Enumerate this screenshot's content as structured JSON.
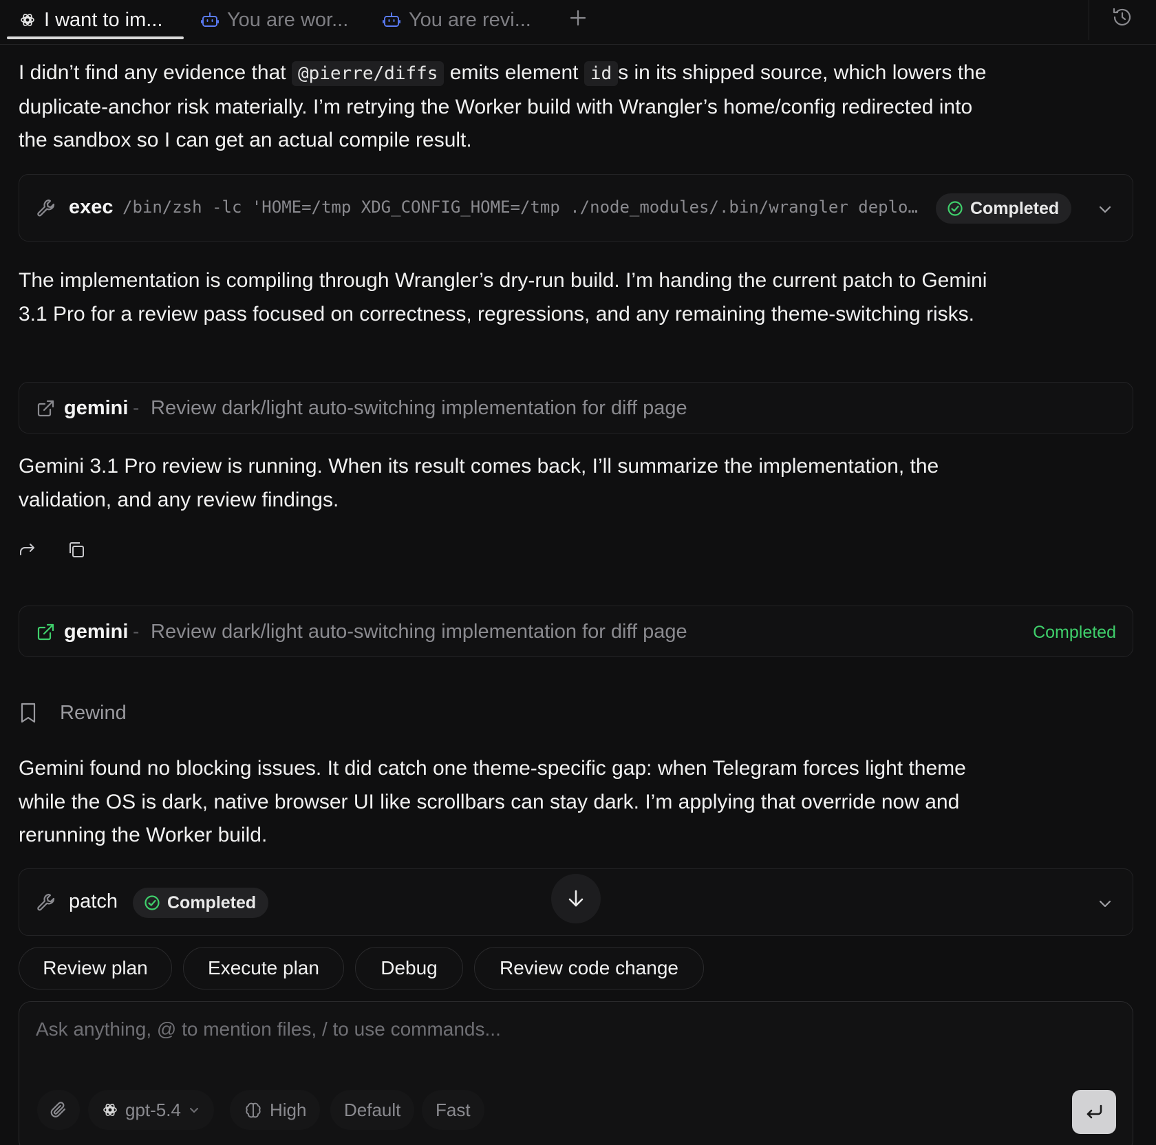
{
  "tabs": [
    {
      "label": "I want to im...",
      "icon": "openai-icon",
      "active": true
    },
    {
      "label": "You are wor...",
      "icon": "robot-icon",
      "active": false
    },
    {
      "label": "You are revi...",
      "icon": "robot-icon",
      "active": false
    }
  ],
  "messages": {
    "m1": {
      "t1": "I didn’t find any evidence that ",
      "c1": "@pierre/diffs",
      "t2": " emits element ",
      "c2": "id",
      "t3": "s in its shipped source, which lowers the duplicate-anchor risk materially. I’m retrying the Worker build with Wrangler’s home/config redirected into the sandbox so I can get an actual compile result."
    },
    "m2": "The implementation is compiling through Wrangler’s dry-run build. I’m handing the current patch to Gemini 3.1 Pro for a review pass focused on correctness, regressions, and any remaining theme-switching risks.",
    "m3": "Gemini 3.1 Pro review is running. When its result comes back, I’ll summarize the implementation, the validation, and any review findings.",
    "m4": "Gemini found no blocking issues. It did catch one theme-specific gap: when Telegram forces light theme while the OS is dark, native browser UI like scrollbars can stay dark. I’m applying that override now and rerunning the Worker build."
  },
  "exec_card": {
    "label": "exec",
    "command": "/bin/zsh -lc 'HOME=/tmp XDG_CONFIG_HOME=/tmp ./node_modules/.bin/wrangler deplo…",
    "status": "Completed"
  },
  "gemini_card_1": {
    "label": "gemini",
    "separator": "-",
    "description": "Review dark/light auto-switching implementation for diff page"
  },
  "gemini_card_2": {
    "label": "gemini",
    "separator": "-",
    "description": "Review dark/light auto-switching implementation for diff page",
    "status": "Completed"
  },
  "rewind": {
    "label": "Rewind"
  },
  "patch_card": {
    "label": "patch",
    "status": "Completed"
  },
  "suggestions": [
    "Review plan",
    "Execute plan",
    "Debug",
    "Review code change"
  ],
  "composer": {
    "placeholder": "Ask anything, @ to mention files, / to use commands...",
    "model": "gpt-5.4",
    "reasoning": "High",
    "mode": "Default",
    "speed": "Fast"
  },
  "colors": {
    "background": "#0f0f10",
    "success": "#3fcf6b",
    "accent_icon": "#5b7cf7"
  }
}
